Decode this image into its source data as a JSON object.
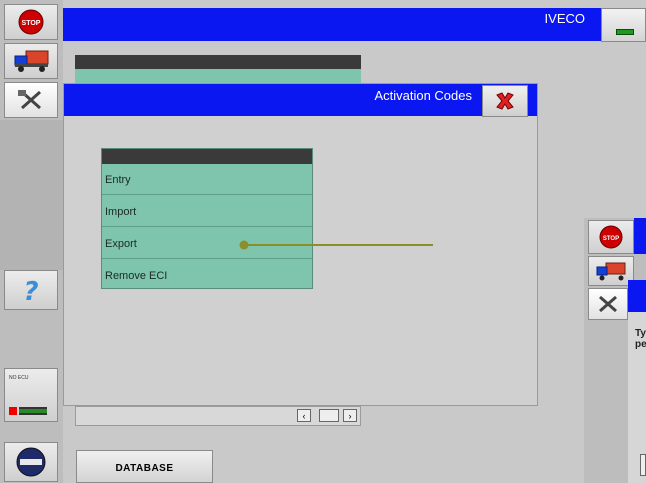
{
  "app": {
    "brand": "IVECO"
  },
  "dialog": {
    "title": "Activation Codes"
  },
  "menu": {
    "items": [
      "Entry",
      "Import",
      "Export",
      "Remove ECI"
    ]
  },
  "footer": {
    "database_label": "DATABASE"
  },
  "sidebar": {
    "small_label": "NO ECU"
  },
  "right_panel": {
    "text_line1": "Ty",
    "text_line2": "pe"
  },
  "colors": {
    "title_blue": "#0a17f0",
    "menu_teal": "#7fc4ad",
    "pointer_olive": "#8a8f2a"
  }
}
